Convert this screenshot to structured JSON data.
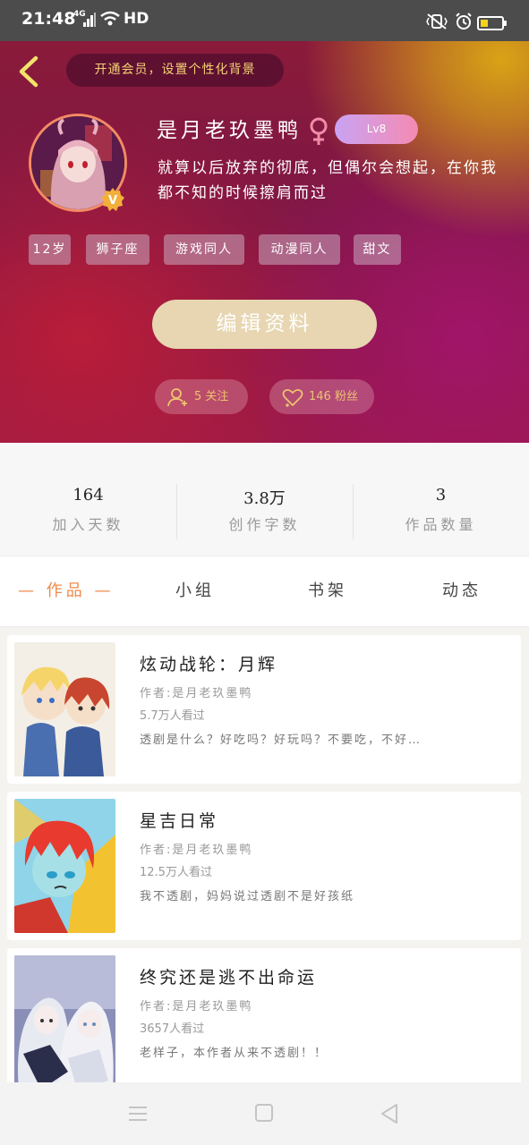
{
  "status_bar": {
    "time": "21:48",
    "network": "4G",
    "hd": "HD"
  },
  "header": {
    "vip_prompt": "开通会员，设置个性化背景",
    "username": "是月老玖墨鸭",
    "level": "Lv8",
    "signature": "就算以后放弃的彻底，但偶尔会想起，在你我都不知的时候擦肩而过",
    "tags": [
      "12岁",
      "狮子座",
      "游戏同人",
      "动漫同人",
      "甜文"
    ],
    "edit_button": "编辑资料",
    "follow": "5 关注",
    "fans": "146 粉丝"
  },
  "stats": [
    {
      "value": "164",
      "label": "加入天数"
    },
    {
      "value": "3.8万",
      "label": "创作字数"
    },
    {
      "value": "3",
      "label": "作品数量"
    }
  ],
  "tabs": [
    {
      "label": "— 作品 —",
      "active": true
    },
    {
      "label": "小组",
      "active": false
    },
    {
      "label": "书架",
      "active": false
    },
    {
      "label": "动态",
      "active": false
    }
  ],
  "works": [
    {
      "title": "炫动战轮：月辉",
      "author": "作者:是月老玖墨鸭",
      "views": "5.7万人看过",
      "desc": "透剧是什么？好吃吗？好玩吗？不要吃，不好…"
    },
    {
      "title": "星吉日常",
      "author": "作者:是月老玖墨鸭",
      "views": "12.5万人看过",
      "desc": "我不透剧，妈妈说过透剧不是好孩纸"
    },
    {
      "title": "终究还是逃不出命运",
      "author": "作者:是月老玖墨鸭",
      "views": "3657人看过",
      "desc": "老样子，本作者从来不透剧！！"
    }
  ]
}
